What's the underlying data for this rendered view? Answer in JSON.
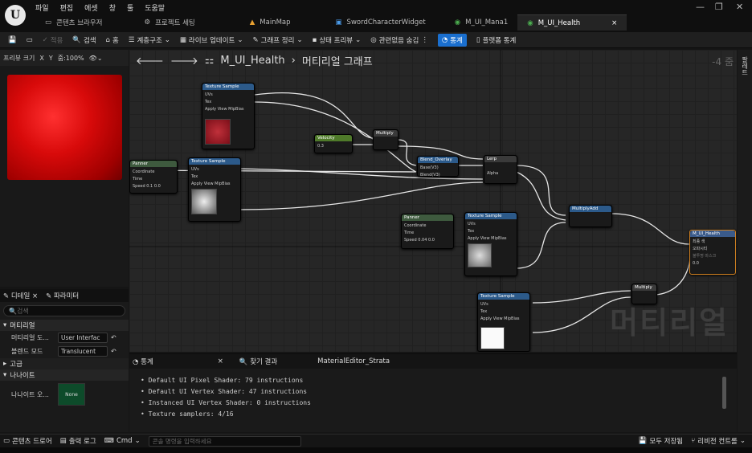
{
  "menu": [
    "파일",
    "편집",
    "에셋",
    "창",
    "툴",
    "도움말"
  ],
  "tabs": [
    {
      "label": "콘텐츠 브라우저",
      "icon": "folder-icon"
    },
    {
      "label": "프로젝트 세팅",
      "icon": "gear-icon"
    },
    {
      "label": "MainMap",
      "icon": "level-icon"
    },
    {
      "label": "SwordCharacterWidget",
      "icon": "widget-icon"
    },
    {
      "label": "M_UI_Mana1",
      "icon": "material-icon"
    },
    {
      "label": "M_UI_Health",
      "icon": "material-icon",
      "active": true
    }
  ],
  "toolbar": {
    "apply": "적용",
    "search": "검색",
    "home": "홈",
    "hierarchy": "계층구조",
    "live_update": "라이브 업데이트",
    "clean_graph": "그래프 정리",
    "state_preview": "상태 프리뷰",
    "hide_unrelated": "관련없음 숨김",
    "stats": "통계",
    "platform_stats": "플랫폼 통계"
  },
  "preview": {
    "size_label": "프리뷰 크기",
    "x": "X",
    "y": "Y",
    "zoom": "줌:100%"
  },
  "breadcrumb": {
    "asset": "M_UI_Health",
    "graph": "머티리얼 그래프",
    "zoom": "-4 줌"
  },
  "watermark": "머티리얼",
  "details": {
    "tab_details": "디테일",
    "tab_params": "파라미터",
    "search_placeholder": "검색",
    "section_material": "머티리얼",
    "domain_label": "머티리얼 도...",
    "domain_value": "User Interfac",
    "blend_label": "블렌드 모드",
    "blend_value": "Translucent",
    "section_advanced": "고급",
    "section_nanite": "나나이트",
    "nanite_label": "나나이트 오...",
    "nanite_value": "None"
  },
  "nodes": {
    "tex1": "Texture Sample",
    "tex2": "Texture Sample",
    "tex3": "Texture Sample",
    "tex4": "Texture Sample",
    "panner1": "Panner",
    "panner2": "Panner",
    "velocity": "Velocity",
    "multiply1": "Multiply",
    "multiply2": "Multiply",
    "blend": "Blend_Overlay",
    "lerp": "Lerp",
    "multiplyadd": "MultiplyAdd",
    "result": "M_UI_Health",
    "uvs": "UVs",
    "tex": "Tex",
    "apply_mip": "Apply View MipBias",
    "coord": "Coordinate",
    "time": "Time",
    "speed": "Speed",
    "speed1_x": "0.1",
    "speed1_y": "0.0",
    "speed2_x": "0.04",
    "speed2_y": "0.0",
    "velocity_val": "0.3",
    "base": "Base(V3)",
    "blend_in": "Blend(V3)",
    "result_out": "Result",
    "alpha": "Alpha",
    "final_color": "최종 색",
    "opacity": "오파시티",
    "opacity_mask": "불투명 마스크",
    "opacity_mask_val": "0.0"
  },
  "stats_panel": {
    "tab_stats": "통계",
    "tab_find": "찾기 결과",
    "title": "MaterialEditor_Strata",
    "lines": [
      "Default UI Pixel Shader: 79 instructions",
      "Default UI Vertex Shader: 47 instructions",
      "Instanced UI Vertex Shader: 0 instructions",
      "Texture samplers: 4/16"
    ]
  },
  "bottom": {
    "content_drawer": "콘텐츠 드로어",
    "output_log": "출력 로그",
    "cmd": "Cmd",
    "cmd_placeholder": "콘솔 명령을 입력하세요",
    "save_all": "모두 저장됨",
    "revision": "리비전 컨트롤"
  },
  "right_strip": {
    "label": "팔레트"
  }
}
